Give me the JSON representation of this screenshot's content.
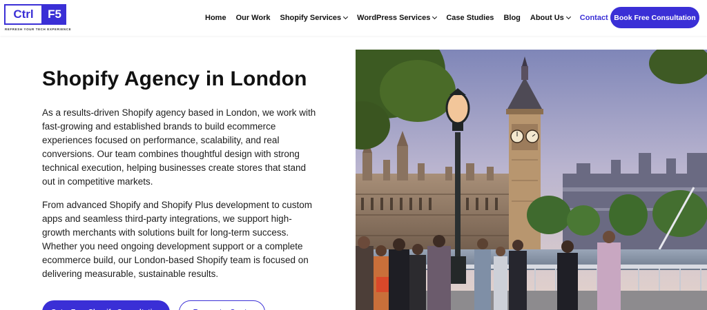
{
  "header": {
    "logo": {
      "left": "Ctrl",
      "right": "F5",
      "tagline": "REFRESH YOUR TECH EXPERIENCE"
    },
    "nav": [
      {
        "label": "Home",
        "dropdown": false
      },
      {
        "label": "Our Work",
        "dropdown": false
      },
      {
        "label": "Shopify Services",
        "dropdown": true
      },
      {
        "label": "WordPress Services",
        "dropdown": true
      },
      {
        "label": "Case Studies",
        "dropdown": false
      },
      {
        "label": "Blog",
        "dropdown": false
      },
      {
        "label": "About Us",
        "dropdown": true
      },
      {
        "label": "Contact Us",
        "dropdown": false,
        "active": true
      }
    ],
    "cta_label": "Book Free Consultation"
  },
  "hero": {
    "title": "Shopify Agency in London",
    "paragraph_1": "As a results-driven Shopify agency based in London, we work with fast-growing and established brands to build ecommerce experiences focused on performance, scalability, and real conversions. Our team combines thoughtful design with strong technical execution, helping businesses create stores that stand out in competitive markets.",
    "paragraph_2": "From advanced Shopify and Shopify Plus development to custom apps and seamless third-party integrations, we support high-growth merchants with solutions built for long-term success. Whether you need ongoing development support or a complete ecommerce build, our London-based Shopify team is focused on delivering measurable, sustainable results.",
    "primary_button": "Get a Free Shopify Consultation",
    "secondary_button": "Request a Quote"
  },
  "colors": {
    "accent": "#3a2fd6"
  },
  "image": {
    "subject": "london-big-ben-photo"
  }
}
